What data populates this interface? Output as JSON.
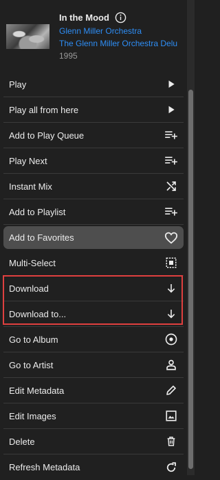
{
  "header": {
    "title": "In the Mood",
    "artist": "Glenn Miller Orchestra",
    "album": "The Glenn Miller Orchestra Delu",
    "year": "1995"
  },
  "menu": {
    "items": [
      {
        "label": "Play",
        "icon": "play-icon"
      },
      {
        "label": "Play all from here",
        "icon": "play-icon"
      },
      {
        "label": "Add to Play Queue",
        "icon": "playlist-add-icon"
      },
      {
        "label": "Play Next",
        "icon": "playlist-add-icon"
      },
      {
        "label": "Instant Mix",
        "icon": "shuffle-icon"
      },
      {
        "label": "Add to Playlist",
        "icon": "playlist-add-icon"
      },
      {
        "label": "Add to Favorites",
        "icon": "heart-icon"
      },
      {
        "label": "Multi-Select",
        "icon": "select-all-icon"
      },
      {
        "label": "Download",
        "icon": "download-arrow-icon"
      },
      {
        "label": "Download to...",
        "icon": "download-arrow-icon"
      },
      {
        "label": "Go to Album",
        "icon": "album-disc-icon"
      },
      {
        "label": "Go to Artist",
        "icon": "person-icon"
      },
      {
        "label": "Edit Metadata",
        "icon": "pencil-icon"
      },
      {
        "label": "Edit Images",
        "icon": "image-icon"
      },
      {
        "label": "Delete",
        "icon": "trash-icon"
      },
      {
        "label": "Refresh Metadata",
        "icon": "refresh-icon"
      }
    ]
  },
  "colors": {
    "background": "#202020",
    "link": "#2e8ef6",
    "highlight": "#4e4e4e",
    "annotation_box": "#e0403f"
  }
}
